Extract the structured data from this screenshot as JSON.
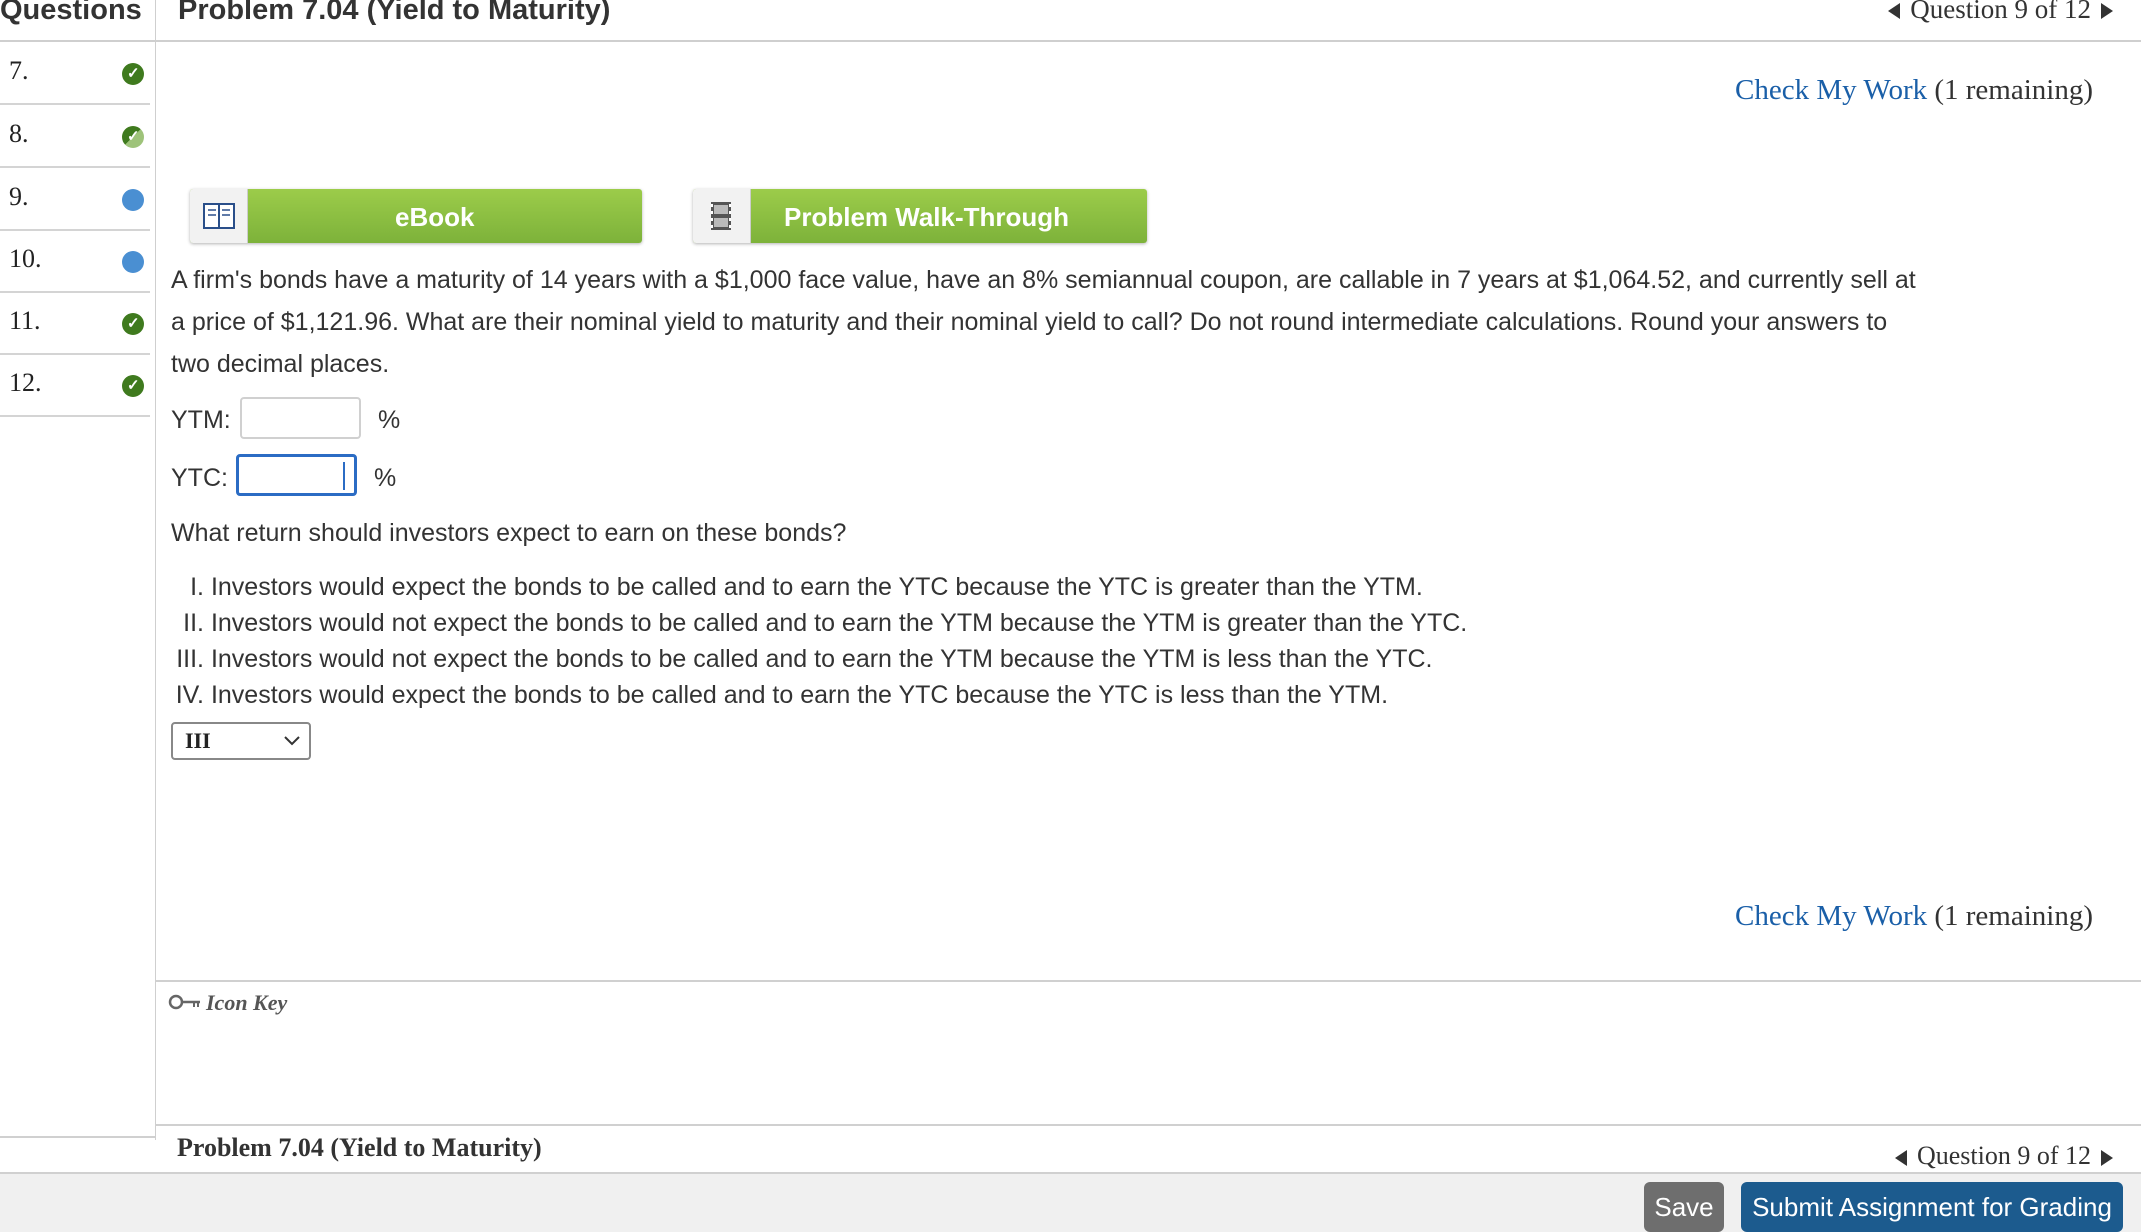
{
  "sidebar": {
    "title": "Questions",
    "items": [
      {
        "number": "7.",
        "status": "complete"
      },
      {
        "number": "8.",
        "status": "partial"
      },
      {
        "number": "9.",
        "status": "current"
      },
      {
        "number": "10.",
        "status": "unanswered"
      },
      {
        "number": "11.",
        "status": "complete"
      },
      {
        "number": "12.",
        "status": "complete"
      }
    ]
  },
  "header": {
    "title": "Problem 7.04 (Yield to Maturity)",
    "nav_label": "Question 9 of 12"
  },
  "check_work": {
    "link": "Check My Work",
    "remaining": "(1 remaining)"
  },
  "resources": {
    "ebook_label": "eBook",
    "walkthrough_label": "Problem Walk-Through"
  },
  "question": {
    "text_line1": "A firm's bonds have a maturity of 14 years with a $1,000 face value, have an 8% semiannual coupon, are callable in 7 years at $1,064.52, and currently sell at",
    "text_line2": "a price of $1,121.96. What are their nominal yield to maturity and their nominal yield to call? Do not round intermediate calculations. Round your answers to",
    "text_line3": "two decimal places.",
    "ytm_label": "YTM:",
    "ytc_label": "YTC:",
    "percent": "%",
    "ytm_value": "",
    "ytc_value": "",
    "followup": "What return should investors expect to earn on these bonds?",
    "options": [
      {
        "numeral": "I.",
        "text": "Investors would expect the bonds to be called and to earn the YTC because the YTC is greater than the YTM."
      },
      {
        "numeral": "II.",
        "text": "Investors would not expect the bonds to be called and to earn the YTM because the YTM is greater than the YTC."
      },
      {
        "numeral": "III.",
        "text": "Investors would not expect the bonds to be called and to earn the YTM because the YTM is less than the YTC."
      },
      {
        "numeral": "IV.",
        "text": "Investors would expect the bonds to be called and to earn the YTC because the YTC is less than the YTM."
      }
    ],
    "selected_option": "III"
  },
  "icon_key": "Icon Key",
  "footer": {
    "title": "Problem 7.04 (Yield to Maturity)",
    "nav_label": "Question 9 of 12",
    "save_label": "Save",
    "submit_label": "Submit Assignment for Grading"
  },
  "colors": {
    "link": "#1a5fa8",
    "green_button": "#8bbd40",
    "complete": "#3f7a1e",
    "current": "#4a8fd2",
    "submit": "#1c5b8e"
  }
}
